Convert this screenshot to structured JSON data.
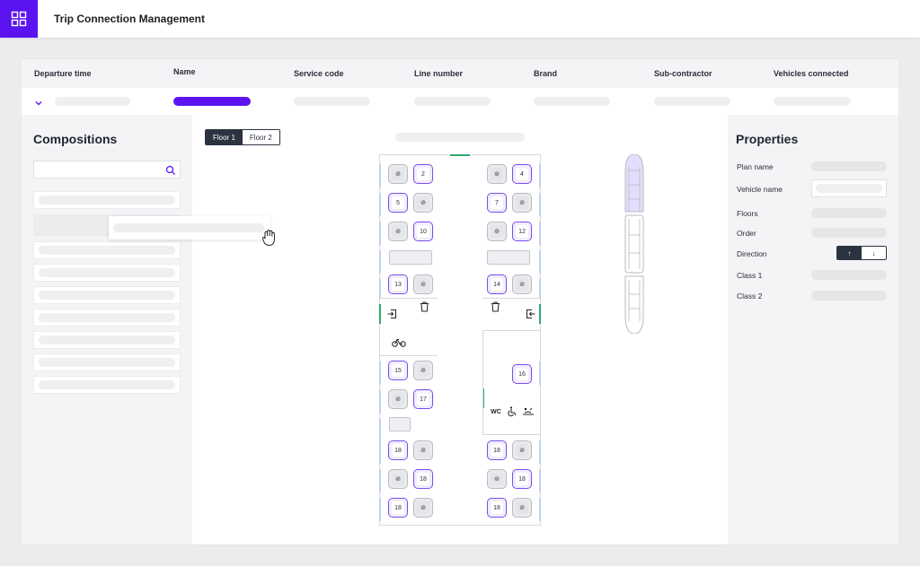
{
  "app": {
    "title": "Trip Connection Management",
    "accent_color": "#5b14f0",
    "menu_icon": "grid-icon"
  },
  "table": {
    "columns": [
      "Departure time",
      "Name",
      "Service code",
      "Line number",
      "Brand",
      "Sub-contractor",
      "Vehicles connected"
    ]
  },
  "compositions": {
    "title": "Compositions",
    "search_placeholder": "",
    "search_icon": "search-icon"
  },
  "floors": {
    "tabs": [
      "Floor 1",
      "Floor 2"
    ],
    "active": "Floor 1"
  },
  "coach": {
    "seat_numbers": {
      "s2": "2",
      "s4": "4",
      "s5": "5",
      "s7": "7",
      "s10": "10",
      "s12": "12",
      "s13": "13",
      "s14": "14",
      "s15": "15",
      "s16": "16",
      "s17": "17",
      "s18": "18"
    },
    "wc_label": "WC"
  },
  "properties": {
    "title": "Properties",
    "labels": {
      "plan_name": "Plan name",
      "vehicle_name": "Vehicle name",
      "floors": "Floors",
      "order": "Order",
      "direction": "Direction",
      "class1": "Class 1",
      "class2": "Class 2"
    },
    "direction_up": "↑",
    "direction_down": "↓"
  }
}
